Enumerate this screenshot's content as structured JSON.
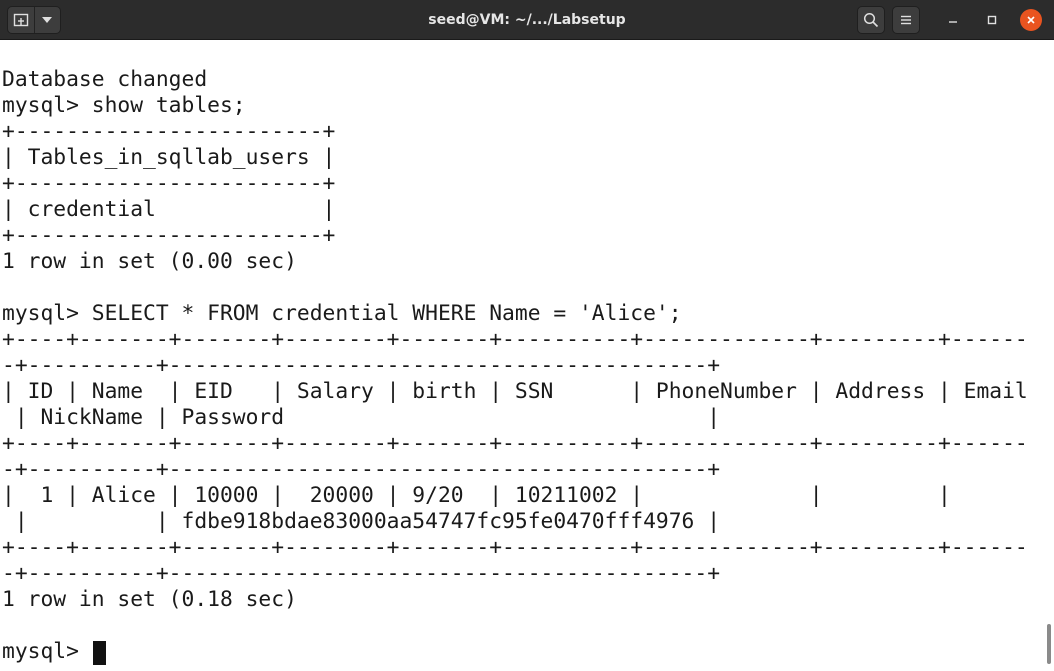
{
  "window": {
    "title": "seed@VM: ~/.../Labsetup",
    "colors": {
      "titlebar": "#2c2c2c",
      "close_button": "#e95420",
      "terminal_bg": "#ffffff",
      "terminal_fg": "#1a1a1a"
    }
  },
  "titlebar": {
    "icons": {
      "new_tab": "new-tab-icon",
      "menu_dropdown": "chevron-down-icon",
      "search": "search-icon",
      "hamburger": "hamburger-menu-icon",
      "minimize": "minimize-icon",
      "maximize": "maximize-icon",
      "close": "close-icon"
    }
  },
  "terminal": {
    "lines": [
      "",
      "Database changed",
      "mysql> show tables;",
      "+------------------------+",
      "| Tables_in_sqllab_users |",
      "+------------------------+",
      "| credential             |",
      "+------------------------+",
      "1 row in set (0.00 sec)",
      "",
      "mysql> SELECT * FROM credential WHERE Name = 'Alice';",
      "+----+-------+-------+--------+-------+----------+-------------+---------+------",
      "-+----------+------------------------------------------+",
      "| ID | Name  | EID   | Salary | birth | SSN      | PhoneNumber | Address | Email",
      " | NickName | Password                                 |",
      "+----+-------+-------+--------+-------+----------+-------------+---------+------",
      "-+----------+------------------------------------------+",
      "|  1 | Alice | 10000 |  20000 | 9/20  | 10211002 |             |         |",
      " |          | fdbe918bdae83000aa54747fc95fe0470fff4976 |",
      "+----+-------+-------+--------+-------+----------+-------------+---------+------",
      "-+----------+------------------------------------------+",
      "1 row in set (0.18 sec)",
      "",
      "mysql> "
    ]
  }
}
